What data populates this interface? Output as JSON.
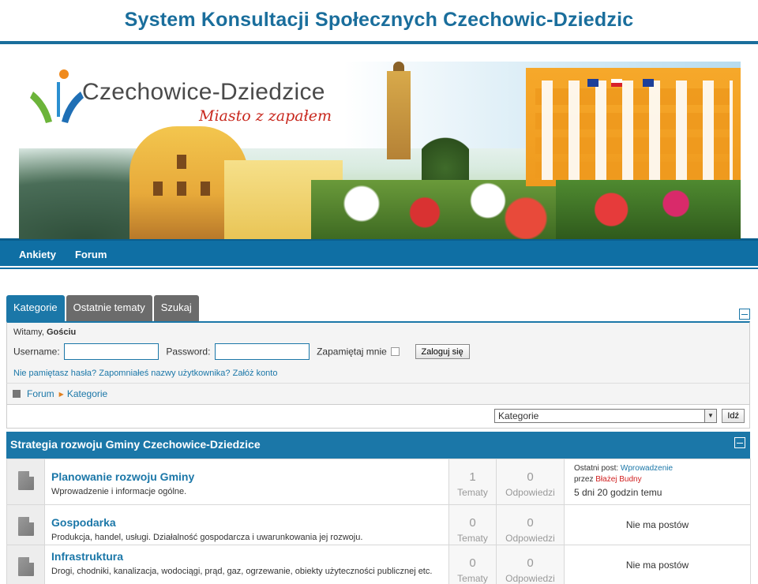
{
  "site": {
    "title": "System Konsultacji Społecznych Czechowic-Dziedzic",
    "logo_text": "Czechowice-Dziedzice",
    "slogan": "Miasto z zapałem"
  },
  "nav": {
    "items": [
      "Ankiety",
      "Forum"
    ]
  },
  "tabs": [
    "Kategorie",
    "Ostatnie tematy",
    "Szukaj"
  ],
  "login": {
    "welcome_prefix": "Witamy, ",
    "guest": "Gościu",
    "username_label": "Username:",
    "username_value": "",
    "password_label": "Password:",
    "password_value": "",
    "remember_label": "Zapamiętaj mnie",
    "login_button": "Zaloguj się",
    "forgot_password": "Nie pamiętasz hasła?",
    "forgot_username": "Zapomniałeś nazwy użytkownika?",
    "register": "Załóż konto"
  },
  "breadcrumb": {
    "forum": "Forum",
    "current": "Kategorie"
  },
  "jump": {
    "selected": "Kategorie",
    "button": "Idź"
  },
  "category": {
    "title": "Strategia rozwoju Gminy Czechowice-Dziedzice",
    "topics_label": "Tematy",
    "replies_label": "Odpowiedzi",
    "no_posts": "Nie ma postów",
    "last_post_prefix": "Ostatni post: ",
    "by_prefix": "przez ",
    "forums": [
      {
        "name": "Planowanie rozwoju Gminy",
        "description": "Wprowadzenie i informacje ogólne.",
        "topics": "1",
        "replies": "0",
        "last_post_title": "Wprowadzenie",
        "last_post_author": "Błażej Budny",
        "last_post_time": "5 dni 20 godzin temu"
      },
      {
        "name": "Gospodarka",
        "description": "Produkcja, handel, usługi. Działalność gospodarcza i uwarunkowania jej rozwoju.",
        "topics": "0",
        "replies": "0"
      },
      {
        "name": "Infrastruktura",
        "description": "Drogi, chodniki, kanalizacja, wodociągi, prąd, gaz, ogrzewanie, obiekty użyteczności publicznej etc.",
        "topics": "0",
        "replies": "0"
      }
    ]
  }
}
